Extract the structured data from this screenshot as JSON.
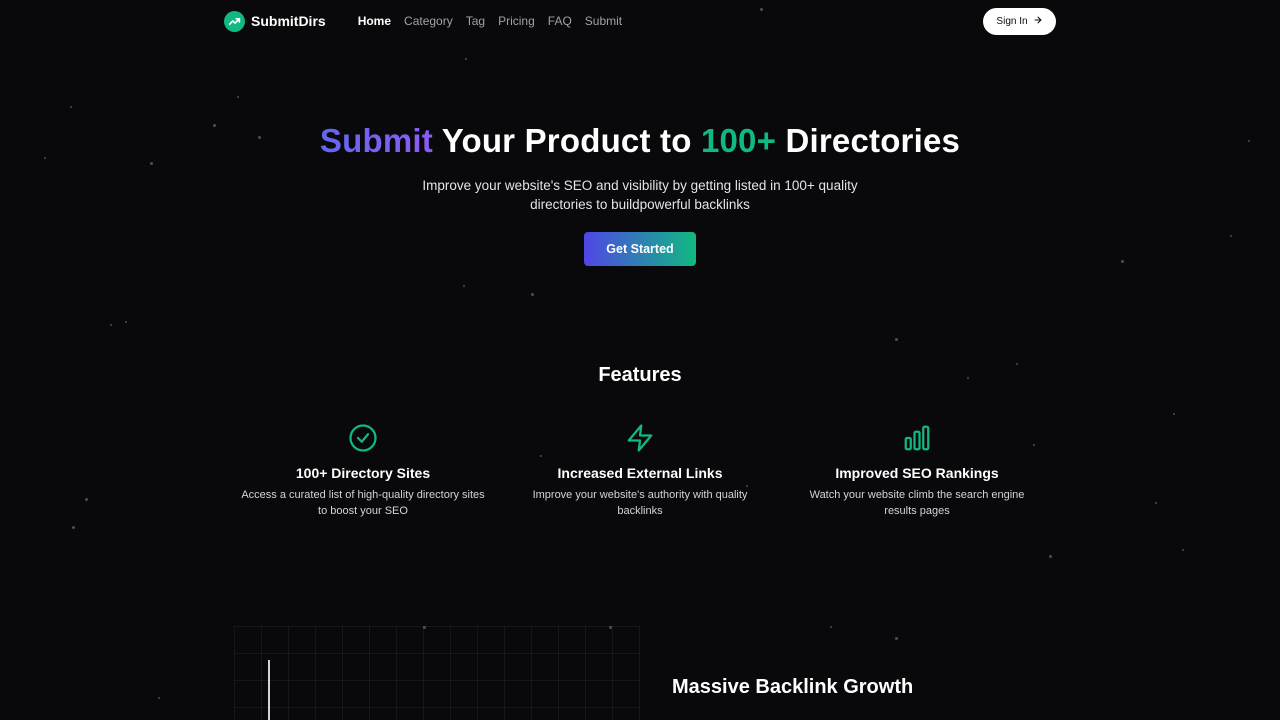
{
  "header": {
    "brand": "SubmitDirs",
    "nav": [
      {
        "label": "Home",
        "active": true
      },
      {
        "label": "Category",
        "active": false
      },
      {
        "label": "Tag",
        "active": false
      },
      {
        "label": "Pricing",
        "active": false
      },
      {
        "label": "FAQ",
        "active": false
      },
      {
        "label": "Submit",
        "active": false
      }
    ],
    "signin_label": "Sign In"
  },
  "hero": {
    "title_part1": "Submit",
    "title_part2": " Your Product to ",
    "title_part3": "100+",
    "title_part4": " Directories",
    "subtitle": "Improve your website's SEO and visibility by getting listed in 100+ quality directories to buildpowerful backlinks",
    "cta_label": "Get Started"
  },
  "features": {
    "title": "Features",
    "items": [
      {
        "icon": "check-circle-icon",
        "title": "100+ Directory Sites",
        "desc": "Access a curated list of high-quality directory sites to boost your SEO"
      },
      {
        "icon": "lightning-icon",
        "title": "Increased External Links",
        "desc": "Improve your website's authority with quality backlinks"
      },
      {
        "icon": "bar-chart-icon",
        "title": "Improved SEO Rankings",
        "desc": "Watch your website climb the search engine results pages"
      }
    ]
  },
  "growth": {
    "title": "Massive Backlink Growth"
  },
  "colors": {
    "background": "#09090b",
    "accent_green": "#10b981",
    "accent_indigo": "#4f46e5"
  }
}
